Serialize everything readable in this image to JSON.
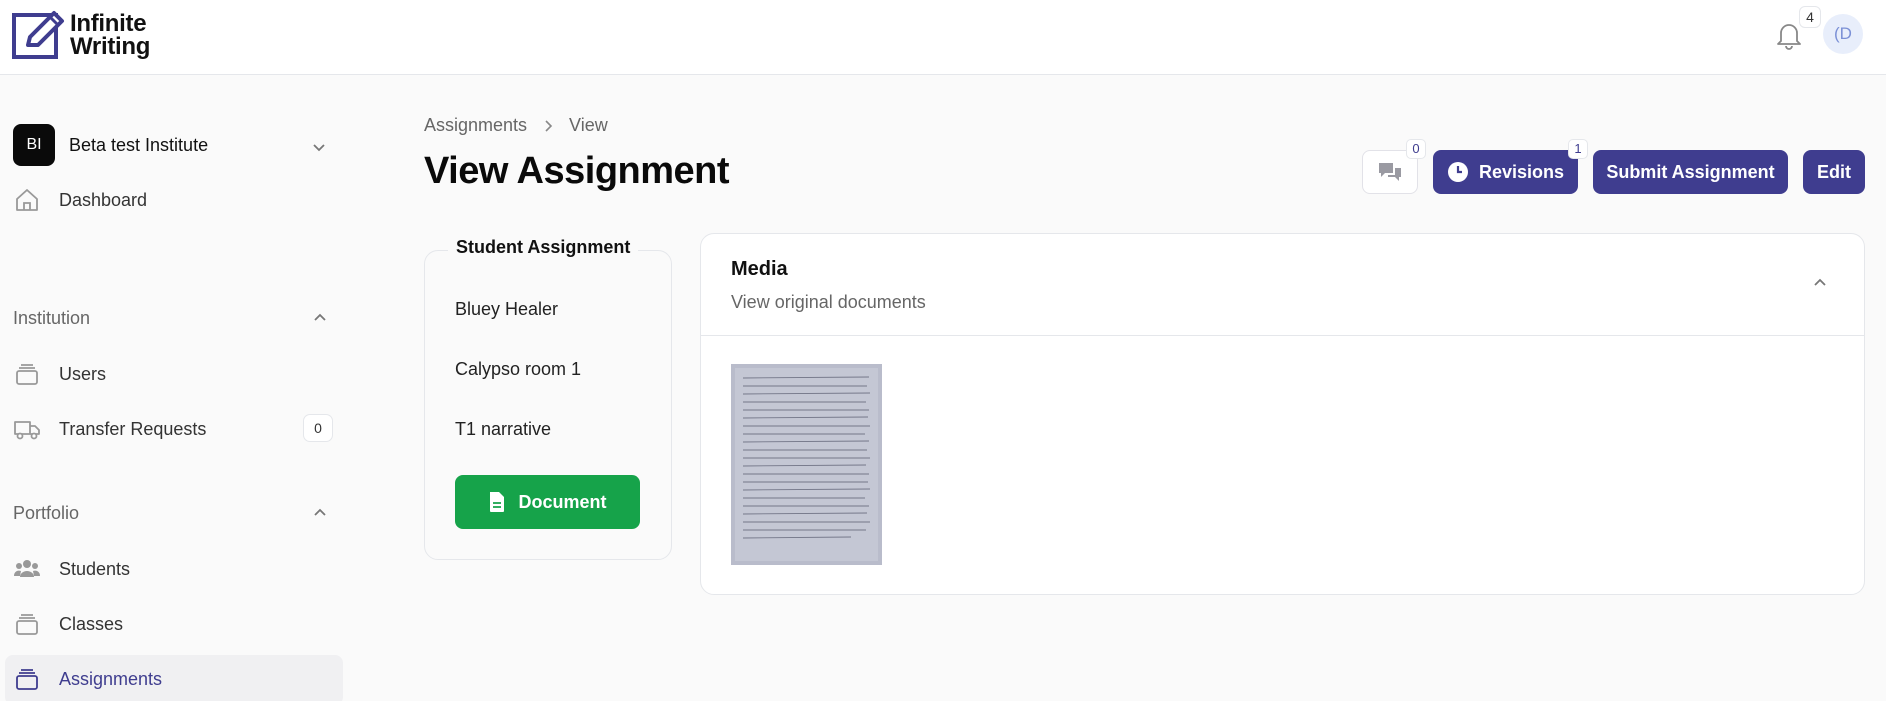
{
  "app": {
    "logo_line1": "Infinite",
    "logo_line2": "Writing",
    "logo_icon": "pen-square-icon",
    "notifications_count": "4",
    "avatar_initials": "(D"
  },
  "sidebar": {
    "institution_initials": "BI",
    "institution_name": "Beta test Institute",
    "dashboard": "Dashboard",
    "institution_section": "Institution",
    "users": "Users",
    "transfer_requests": "Transfer Requests",
    "transfer_requests_count": "0",
    "portfolio_section": "Portfolio",
    "students": "Students",
    "classes": "Classes",
    "assignments": "Assignments"
  },
  "breadcrumb": {
    "root": "Assignments",
    "current": "View"
  },
  "page": {
    "title": "View Assignment"
  },
  "actions": {
    "comments_count": "0",
    "revisions_label": "Revisions",
    "revisions_count": "1",
    "submit_label": "Submit Assignment",
    "edit_label": "Edit"
  },
  "student_assignment": {
    "title": "Student Assignment",
    "student": "Bluey Healer",
    "class": "Calypso room 1",
    "assignment": "T1 narrative",
    "document_label": "Document"
  },
  "media": {
    "title": "Media",
    "subtitle": "View original documents"
  },
  "colors": {
    "brand": "#3f3d8f",
    "document_button": "#16a34a"
  }
}
